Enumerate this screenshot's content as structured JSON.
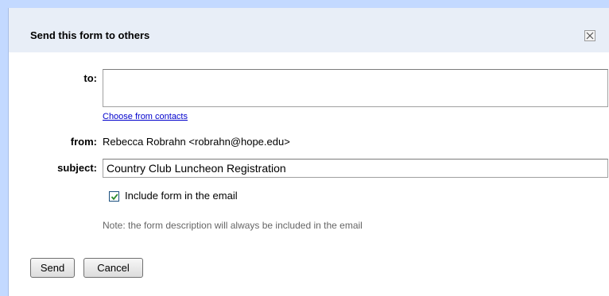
{
  "dialog": {
    "title": "Send this form to others",
    "close_icon": "close-x-icon"
  },
  "form": {
    "to_label": "to:",
    "to_value": "",
    "contacts_link": "Choose from contacts",
    "from_label": "from:",
    "from_value": "Rebecca Robrahn <robrahn@hope.edu>",
    "subject_label": "subject:",
    "subject_value": "Country Club Luncheon Registration",
    "include_label": "Include form in the email",
    "include_checked": true,
    "note": "Note: the form description will always be included in the email"
  },
  "buttons": {
    "send_label": "Send",
    "cancel_label": "Cancel"
  },
  "colors": {
    "titlebar": "#e8eef7",
    "background": "#c3d9ff",
    "link": "#0000cc",
    "check": "#2b8a2b"
  }
}
